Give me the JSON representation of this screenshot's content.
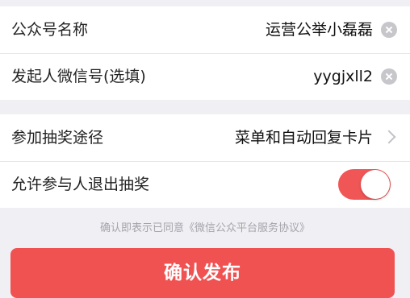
{
  "form_top": {
    "account_name_label": "公众号名称",
    "account_name_value": "运营公举小磊磊",
    "initiator_wechat_label": "发起人微信号(选填)",
    "initiator_wechat_value": "yygjxll2"
  },
  "form_bottom": {
    "entry_method_label": "参加抽奖途径",
    "entry_method_value": "菜单和自动回复卡片",
    "allow_exit_label": "允许参与人退出抽奖",
    "allow_exit_enabled": true
  },
  "agreement_text": "确认即表示已同意《微信公众平台服务协议》",
  "confirm_button_label": "确认发布",
  "colors": {
    "accent": "#f05252",
    "background": "#f0eff4"
  }
}
